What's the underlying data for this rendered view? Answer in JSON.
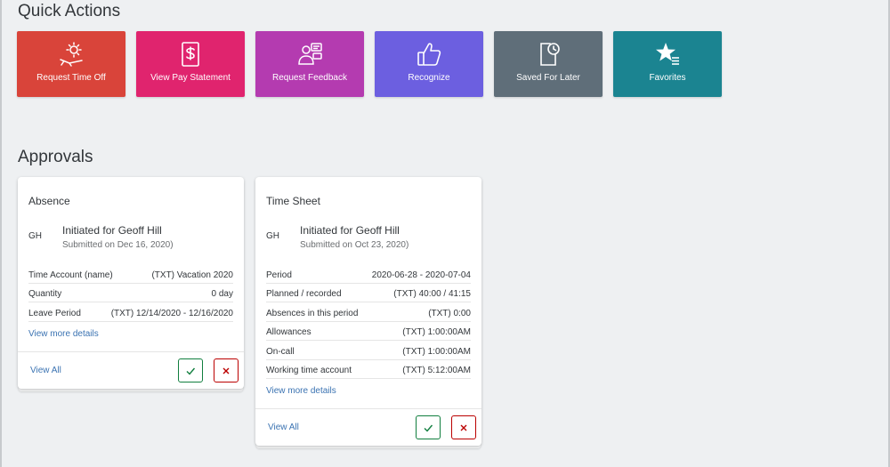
{
  "quick_actions": {
    "title": "Quick Actions",
    "tiles": [
      {
        "label": "Request Time Off",
        "icon": "beach-sun-icon",
        "color": "#d9443a"
      },
      {
        "label": "View Pay Statement",
        "icon": "dollar-document-icon",
        "color": "#e0246e"
      },
      {
        "label": "Request Feedback",
        "icon": "people-chat-icon",
        "color": "#b43bb0"
      },
      {
        "label": "Recognize",
        "icon": "thumbs-up-icon",
        "color": "#6c5fe0"
      },
      {
        "label": "Saved For Later",
        "icon": "document-clock-icon",
        "color": "#5f6e79"
      },
      {
        "label": "Favorites",
        "icon": "star-list-icon",
        "color": "#1b8491"
      }
    ]
  },
  "approvals": {
    "title": "Approvals",
    "cards": [
      {
        "title": "Absence",
        "initials": "GH",
        "initiated": "Initiated for Geoff Hill",
        "submitted": "Submitted on Dec 16, 2020)",
        "rows": [
          {
            "label": "Time Account (name)",
            "value": "(TXT) Vacation 2020"
          },
          {
            "label": "Quantity",
            "value": "0 day"
          },
          {
            "label": "Leave Period",
            "value": "(TXT) 12/14/2020 - 12/16/2020"
          }
        ],
        "more": "View more details",
        "view_all": "View All"
      },
      {
        "title": "Time Sheet",
        "initials": "GH",
        "initiated": "Initiated for Geoff Hill",
        "submitted": "Submitted on Oct 23, 2020)",
        "rows": [
          {
            "label": "Period",
            "value": "2020-06-28 - 2020-07-04"
          },
          {
            "label": "Planned / recorded",
            "value": "(TXT) 40:00 / 41:15"
          },
          {
            "label": "Absences in this period",
            "value": "(TXT) 0:00"
          },
          {
            "label": "Allowances",
            "value": "(TXT) 1:00:00AM"
          },
          {
            "label": "On-call",
            "value": "(TXT) 1:00:00AM"
          },
          {
            "label": "Working time account",
            "value": "(TXT) 5:12:00AM"
          }
        ],
        "more": "View more details",
        "view_all": "View All"
      }
    ]
  },
  "colors": {
    "approve": "#107e3e",
    "reject": "#bb0000",
    "link": "#3b73b2"
  }
}
